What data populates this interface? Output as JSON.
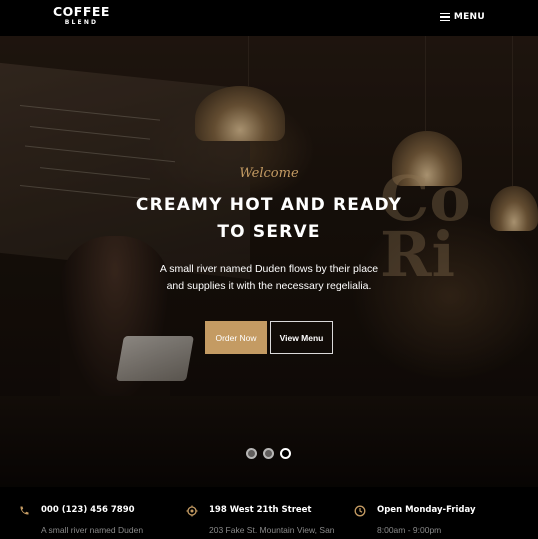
{
  "brand": {
    "main": "COFFEE",
    "sub": "BLEND"
  },
  "nav": {
    "menu_label": "MENU",
    "menu_icon": "hamburger-icon"
  },
  "hero": {
    "welcome": "Welcome",
    "headline_line1": "CREAMY HOT AND READY",
    "headline_line2": "TO SERVE",
    "subtext_line1": "A small river named Duden flows by their place",
    "subtext_line2": "and supplies it with the necessary regelialia.",
    "buttons": {
      "order": "Order Now",
      "view": "View Menu"
    },
    "slides_count": 3,
    "active_slide": 3
  },
  "info": [
    {
      "icon": "phone-icon",
      "title": "000 (123) 456 7890",
      "desc": "A small river named Duden"
    },
    {
      "icon": "location-icon",
      "title": "198 West 21th Street",
      "desc": "203 Fake St. Mountain View, San"
    },
    {
      "icon": "clock-icon",
      "title": "Open Monday-Friday",
      "desc": "8:00am - 9:00pm"
    }
  ],
  "colors": {
    "accent": "#c49b63",
    "background": "#000000"
  }
}
